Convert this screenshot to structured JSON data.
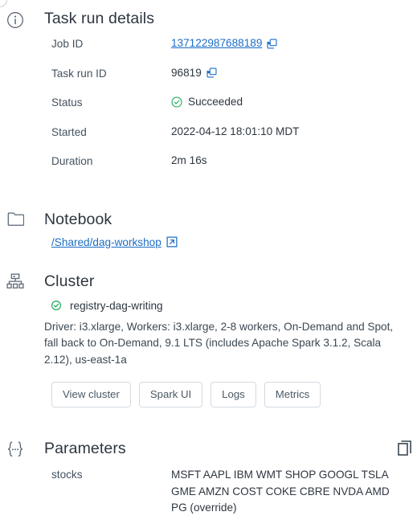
{
  "task_run_details": {
    "icon": "info-circle-icon",
    "title": "Task run details",
    "rows": [
      {
        "label": "Job ID",
        "value": "137122987688189",
        "type": "link-with-copy"
      },
      {
        "label": "Task run ID",
        "value": "96819",
        "type": "text-with-copy"
      },
      {
        "label": "Status",
        "value": "Succeeded",
        "type": "status-success"
      },
      {
        "label": "Started",
        "value": "2022-04-12 18:01:10 MDT",
        "type": "text"
      },
      {
        "label": "Duration",
        "value": "2m 16s",
        "type": "text"
      }
    ]
  },
  "notebook": {
    "icon": "folder-icon",
    "title": "Notebook",
    "path": "/Shared/dag-workshop",
    "external_link_icon": "external-link-icon"
  },
  "cluster": {
    "icon": "cluster-hierarchy-icon",
    "title": "Cluster",
    "status_icon": "check-circle-icon",
    "name": "registry-dag-writing",
    "description": "Driver: i3.xlarge, Workers: i3.xlarge, 2-8 workers, On-Demand and Spot, fall back to On-Demand, 9.1 LTS (includes Apache Spark 3.1.2, Scala 2.12), us-east-1a",
    "buttons": [
      {
        "label": "View cluster"
      },
      {
        "label": "Spark UI"
      },
      {
        "label": "Logs"
      },
      {
        "label": "Metrics"
      }
    ]
  },
  "parameters": {
    "icon": "curly-braces-icon",
    "title": "Parameters",
    "copy_icon": "copy-icon",
    "rows": [
      {
        "key": "stocks",
        "value": "MSFT AAPL IBM WMT SHOP GOOGL TSLA GME AMZN COST COKE CBRE NVDA AMD PG (override)"
      }
    ]
  },
  "colors": {
    "link": "#1b6dc4",
    "success": "#1aab5b",
    "text": "#2d3640",
    "muted": "#44525f",
    "icon": "#5b6875",
    "border": "#d3dae0",
    "background": "#ffffff"
  }
}
